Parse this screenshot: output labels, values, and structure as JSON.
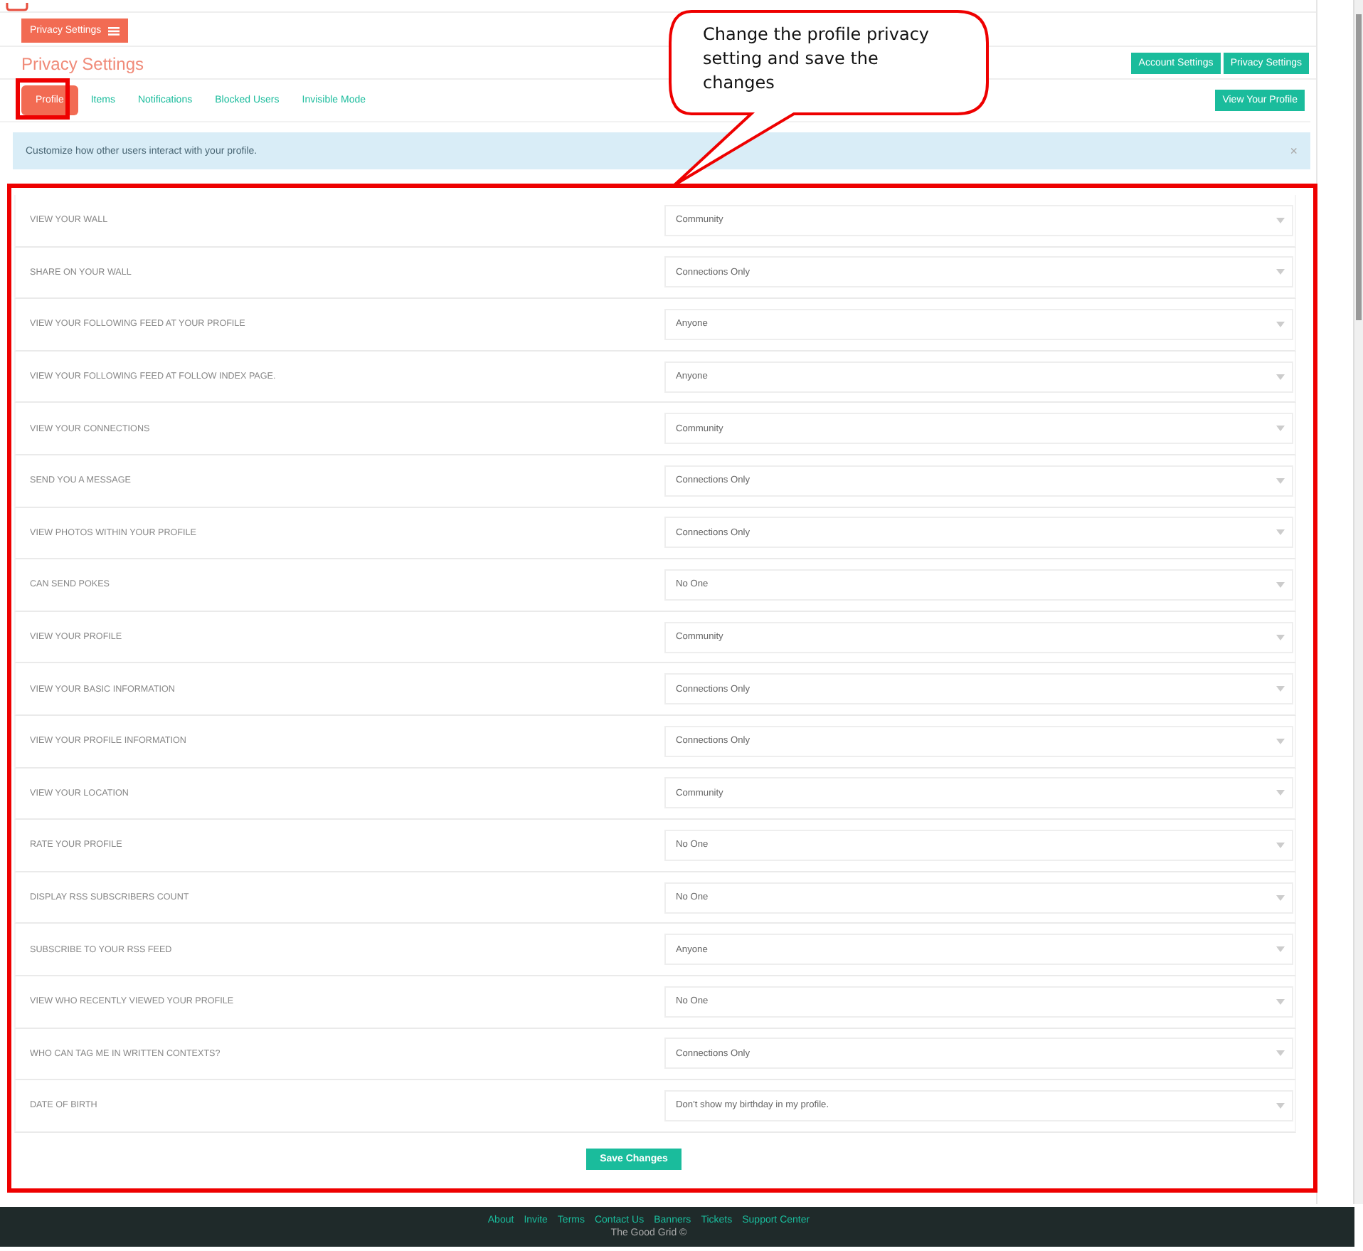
{
  "header_button": "Privacy Settings",
  "page_title": "Privacy Settings",
  "top_buttons": [
    "Account Settings",
    "Privacy Settings"
  ],
  "tabs": [
    {
      "label": "Profile",
      "selected": true
    },
    {
      "label": "Items",
      "selected": false
    },
    {
      "label": "Notifications",
      "selected": false
    },
    {
      "label": "Blocked Users",
      "selected": false
    },
    {
      "label": "Invisible Mode",
      "selected": false
    }
  ],
  "view_profile_button": "View Your Profile",
  "alert": {
    "text": "Customize how other users interact with your profile.",
    "close": "×"
  },
  "settings": [
    {
      "label": "VIEW YOUR WALL",
      "value": "Community"
    },
    {
      "label": "SHARE ON YOUR WALL",
      "value": "Connections Only"
    },
    {
      "label": "VIEW YOUR FOLLOWING FEED AT YOUR PROFILE",
      "value": "Anyone"
    },
    {
      "label": "VIEW YOUR FOLLOWING FEED AT FOLLOW INDEX PAGE.",
      "value": "Anyone"
    },
    {
      "label": "VIEW YOUR CONNECTIONS",
      "value": "Community"
    },
    {
      "label": "SEND YOU A MESSAGE",
      "value": "Connections Only"
    },
    {
      "label": "VIEW PHOTOS WITHIN YOUR PROFILE",
      "value": "Connections Only"
    },
    {
      "label": "CAN SEND POKES",
      "value": "No One"
    },
    {
      "label": "VIEW YOUR PROFILE",
      "value": "Community"
    },
    {
      "label": "VIEW YOUR BASIC INFORMATION",
      "value": "Connections Only"
    },
    {
      "label": "VIEW YOUR PROFILE INFORMATION",
      "value": "Connections Only"
    },
    {
      "label": "VIEW YOUR LOCATION",
      "value": "Community"
    },
    {
      "label": "RATE YOUR PROFILE",
      "value": "No One"
    },
    {
      "label": "DISPLAY RSS SUBSCRIBERS COUNT",
      "value": "No One"
    },
    {
      "label": "SUBSCRIBE TO YOUR RSS FEED",
      "value": "Anyone"
    },
    {
      "label": "VIEW WHO RECENTLY VIEWED YOUR PROFILE",
      "value": "No One"
    },
    {
      "label": "WHO CAN TAG ME IN WRITTEN CONTEXTS?",
      "value": "Connections Only"
    },
    {
      "label": "DATE OF BIRTH",
      "value": "Don't show my birthday in my profile."
    }
  ],
  "save_button": "Save Changes",
  "footer": {
    "links": [
      "About",
      "Invite",
      "Terms",
      "Contact Us",
      "Banners",
      "Tickets",
      "Support Center"
    ],
    "copyright": "The Good Grid ©"
  },
  "callout": {
    "text": "Change the profile privacy setting and save the changes"
  }
}
